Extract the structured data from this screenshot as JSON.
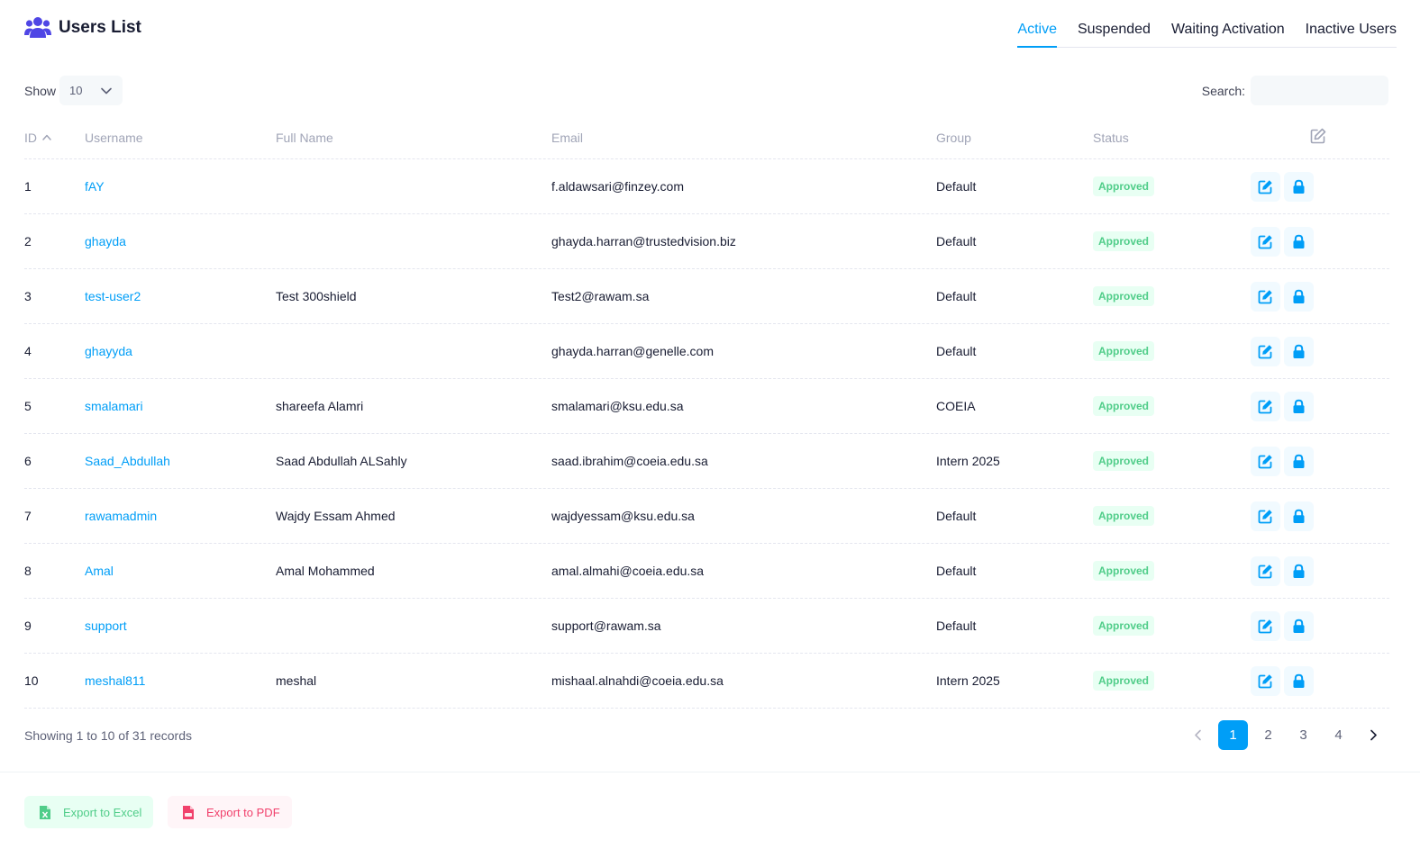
{
  "header": {
    "title": "Users List",
    "tabs": [
      {
        "label": "Active",
        "active": true
      },
      {
        "label": "Suspended",
        "active": false
      },
      {
        "label": "Waiting Activation",
        "active": false
      },
      {
        "label": "Inactive Users",
        "active": false
      }
    ]
  },
  "toolbar": {
    "show_label": "Show",
    "page_size": "10",
    "search_label": "Search:",
    "search_value": ""
  },
  "table": {
    "columns": [
      "ID",
      "Username",
      "Full Name",
      "Email",
      "Group",
      "Status"
    ],
    "rows": [
      {
        "id": "1",
        "username": "fAY",
        "full_name": "",
        "email": "f.aldawsari@finzey.com",
        "group": "Default",
        "status": "Approved"
      },
      {
        "id": "2",
        "username": "ghayda",
        "full_name": "",
        "email": "ghayda.harran@trustedvision.biz",
        "group": "Default",
        "status": "Approved"
      },
      {
        "id": "3",
        "username": "test-user2",
        "full_name": "Test 300shield",
        "email": "Test2@rawam.sa",
        "group": "Default",
        "status": "Approved"
      },
      {
        "id": "4",
        "username": "ghayyda",
        "full_name": "",
        "email": "ghayda.harran@genelle.com",
        "group": "Default",
        "status": "Approved"
      },
      {
        "id": "5",
        "username": "smalamari",
        "full_name": "shareefa Alamri",
        "email": "smalamari@ksu.edu.sa",
        "group": "COEIA",
        "status": "Approved"
      },
      {
        "id": "6",
        "username": "Saad_Abdullah",
        "full_name": "Saad Abdullah ALSahly",
        "email": "saad.ibrahim@coeia.edu.sa",
        "group": "Intern 2025",
        "status": "Approved"
      },
      {
        "id": "7",
        "username": "rawamadmin",
        "full_name": "Wajdy Essam Ahmed",
        "email": "wajdyessam@ksu.edu.sa",
        "group": "Default",
        "status": "Approved"
      },
      {
        "id": "8",
        "username": "Amal",
        "full_name": "Amal Mohammed",
        "email": "amal.almahi@coeia.edu.sa",
        "group": "Default",
        "status": "Approved"
      },
      {
        "id": "9",
        "username": "support",
        "full_name": "",
        "email": "support@rawam.sa",
        "group": "Default",
        "status": "Approved"
      },
      {
        "id": "10",
        "username": "meshal811",
        "full_name": "meshal",
        "email": "mishaal.alnahdi@coeia.edu.sa",
        "group": "Intern 2025",
        "status": "Approved"
      }
    ]
  },
  "footer": {
    "showing_text": "Showing 1 to 10 of 31 records",
    "pages": [
      "1",
      "2",
      "3",
      "4"
    ],
    "current_page": "1",
    "export_excel": "Export to Excel",
    "export_pdf": "Export to PDF"
  },
  "colors": {
    "accent": "#009ef7",
    "success": "#50cd89",
    "danger": "#f1416c",
    "title_icon": "#4f46e5"
  },
  "icons": {
    "title": "users-icon",
    "row_actions": [
      "edit-icon",
      "lock-icon"
    ],
    "header_action": "edit-icon"
  }
}
